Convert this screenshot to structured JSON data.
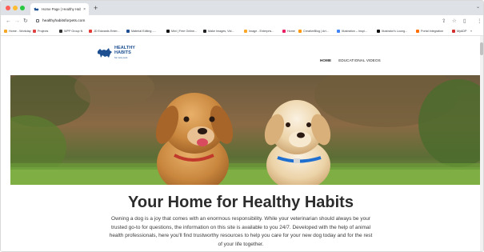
{
  "browser": {
    "tab": {
      "title": "Home Page | Healthy Habits f",
      "close": "×"
    },
    "new_tab": "+",
    "url": "healthyhabitsforpets.com",
    "bookmarks": [
      {
        "label": "Home - Workday",
        "color": "#f5a623"
      },
      {
        "label": "Projects",
        "color": "#e04040"
      },
      {
        "label": "WPP Group N",
        "color": "#333333"
      },
      {
        "label": "JD Edwards Enter...",
        "color": "#e53935"
      },
      {
        "label": "Material Editing -...",
        "color": "#1d4f91"
      },
      {
        "label": "Mini | Free Online...",
        "color": "#111111"
      },
      {
        "label": "Make Images, Vid...",
        "color": "#222222"
      },
      {
        "label": "Image - Enterpris...",
        "color": "#f9a825"
      },
      {
        "label": "Home",
        "color": "#e91e63"
      },
      {
        "label": "CreativeBlog | Art...",
        "color": "#ff9800"
      },
      {
        "label": "Illustration – Inspi...",
        "color": "#4285f4"
      },
      {
        "label": "Illustrator's Loung...",
        "color": "#111111"
      },
      {
        "label": "Portal Integration",
        "color": "#ff6f00"
      },
      {
        "label": "MyADP",
        "color": "#d32f2f"
      }
    ]
  },
  "site": {
    "logo": {
      "line1": "HEALTHY",
      "line2": "HABITS",
      "tagline": "for new pets"
    },
    "nav": [
      {
        "label": "HOME",
        "active": true
      },
      {
        "label": "EDUCATIONAL VIDEOS",
        "active": false
      }
    ],
    "headline": "Your Home for Healthy Habits",
    "intro": "Owning a dog is a joy that comes with an enormous responsibility. While your veterinarian should always be your trusted go-to for questions, the information on this site is available to you 24/7. Developed with the help of animal health professionals, here you'll find trustworthy resources to help you care for your new dog today and for the rest of your life together."
  },
  "colors": {
    "brand_blue": "#1d4f91",
    "chrome_bg": "#dee1e6"
  }
}
